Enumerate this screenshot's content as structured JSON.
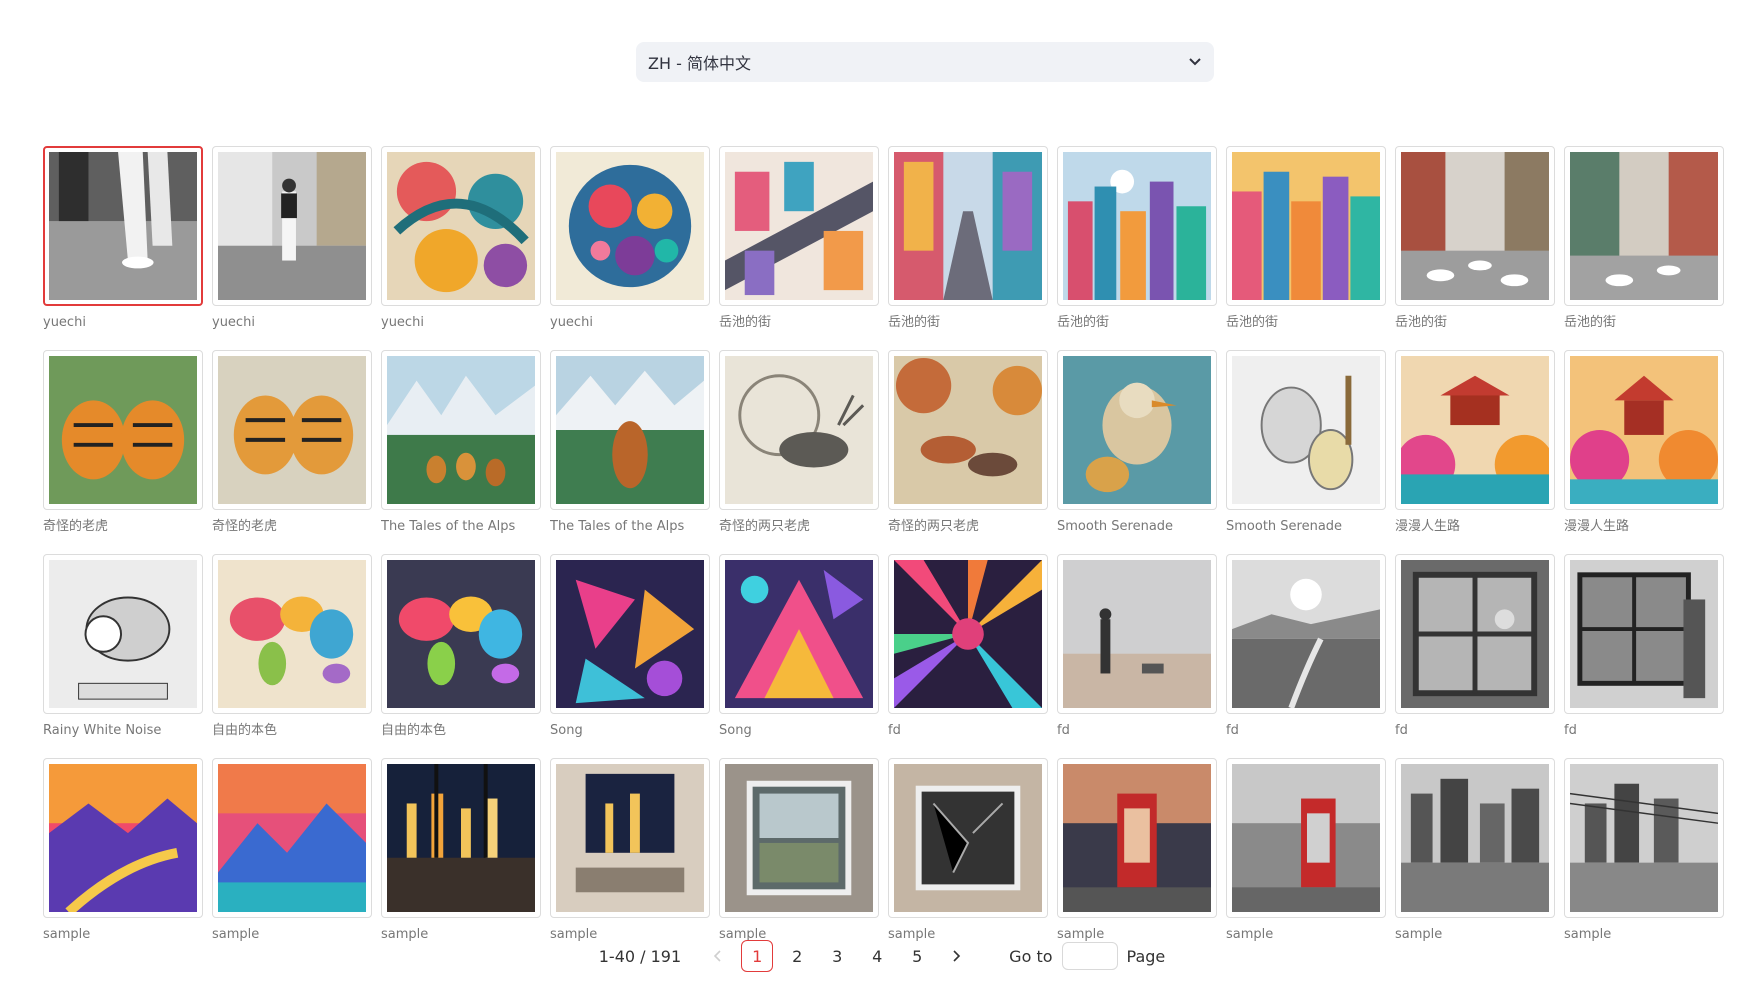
{
  "language_select": {
    "value": "ZH - 简体中文",
    "icon": "chevron-down-icon"
  },
  "gallery": [
    {
      "caption": "yuechi",
      "art": "street-feet",
      "selected": true
    },
    {
      "caption": "yuechi",
      "art": "street-walker"
    },
    {
      "caption": "yuechi",
      "art": "swirl"
    },
    {
      "caption": "yuechi",
      "art": "circles"
    },
    {
      "caption": "岳池的街",
      "art": "city-iso"
    },
    {
      "caption": "岳池的街",
      "art": "city-street"
    },
    {
      "caption": "岳池的街",
      "art": "city-skyline"
    },
    {
      "caption": "岳池的街",
      "art": "city-skyline2"
    },
    {
      "caption": "岳池的街",
      "art": "street-shoes"
    },
    {
      "caption": "岳池的街",
      "art": "street-shoes2"
    },
    {
      "caption": "奇怪的老虎",
      "art": "tigers"
    },
    {
      "caption": "奇怪的老虎",
      "art": "tigers2"
    },
    {
      "caption": "The Tales of the Alps",
      "art": "alps-guitars"
    },
    {
      "caption": "The Tales of the Alps",
      "art": "alps-violin"
    },
    {
      "caption": "奇怪的两只老虎",
      "art": "deer-sketch"
    },
    {
      "caption": "奇怪的两只老虎",
      "art": "deer-forest"
    },
    {
      "caption": "Smooth Serenade",
      "art": "bird-guitar"
    },
    {
      "caption": "Smooth Serenade",
      "art": "bird-sketch"
    },
    {
      "caption": "漫漫人生路",
      "art": "pagoda"
    },
    {
      "caption": "漫漫人生路",
      "art": "pagoda2"
    },
    {
      "caption": "Rainy White Noise",
      "art": "bird-banjo"
    },
    {
      "caption": "自由的本色",
      "art": "world-map"
    },
    {
      "caption": "自由的本色",
      "art": "world-map2"
    },
    {
      "caption": "Song",
      "art": "geo"
    },
    {
      "caption": "Song",
      "art": "geo2"
    },
    {
      "caption": "fd",
      "art": "burst"
    },
    {
      "caption": "fd",
      "art": "man-beach"
    },
    {
      "caption": "fd",
      "art": "bw-landscape"
    },
    {
      "caption": "fd",
      "art": "bw-window"
    },
    {
      "caption": "fd",
      "art": "bw-window2"
    },
    {
      "caption": "sample",
      "art": "sunset-river"
    },
    {
      "caption": "sample",
      "art": "sunset-mountain"
    },
    {
      "caption": "sample",
      "art": "night-window"
    },
    {
      "caption": "sample",
      "art": "night-room"
    },
    {
      "caption": "sample",
      "art": "old-window"
    },
    {
      "caption": "sample",
      "art": "broken-window"
    },
    {
      "caption": "sample",
      "art": "phonebooth"
    },
    {
      "caption": "sample",
      "art": "phonebooth-bw"
    },
    {
      "caption": "sample",
      "art": "bw-city"
    },
    {
      "caption": "sample",
      "art": "bw-city2"
    }
  ],
  "pagination": {
    "total_label": "1-40 / 191",
    "prev_icon": "chevron-left-icon",
    "next_icon": "chevron-right-icon",
    "pages": [
      "1",
      "2",
      "3",
      "4",
      "5"
    ],
    "current": "1",
    "goto_label": "Go to",
    "page_label": "Page"
  }
}
